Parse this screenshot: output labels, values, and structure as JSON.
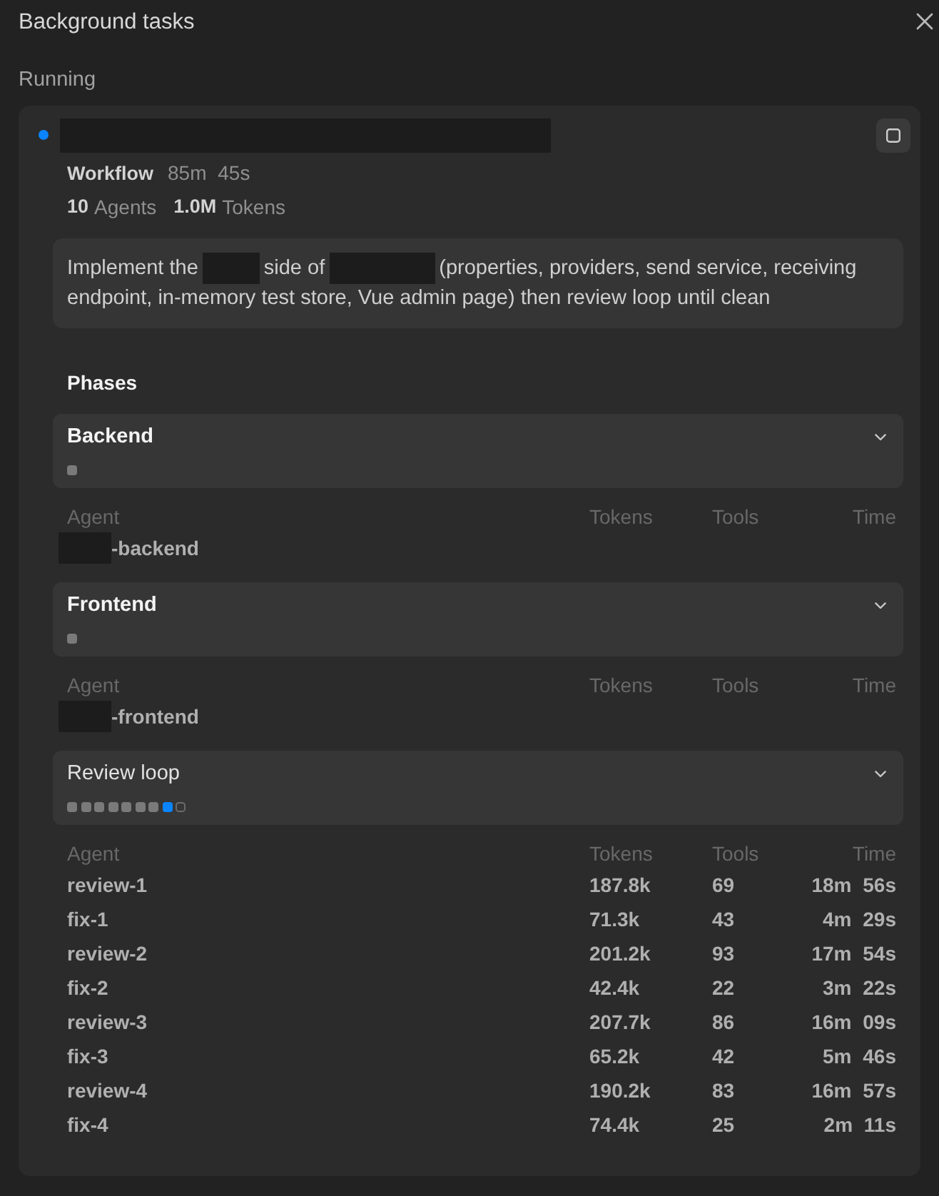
{
  "window": {
    "title": "Background tasks"
  },
  "section": {
    "label": "Running"
  },
  "task": {
    "running": true,
    "title": [
      {
        "kind": "redacted"
      }
    ],
    "type_label": "Workflow",
    "duration": "85m 45s",
    "stats": [
      {
        "count": "10",
        "unit": "Agents"
      },
      {
        "count": "1.0M",
        "unit": "Tokens"
      }
    ],
    "description": [
      [
        {
          "kind": "text",
          "text": "Implement the"
        },
        {
          "kind": "redacted"
        },
        {
          "kind": "text",
          "text": "side of"
        },
        {
          "kind": "redacted"
        },
        {
          "kind": "text",
          "text": "(properties, providers, send service, receiving"
        }
      ],
      [
        {
          "kind": "text",
          "text": "endpoint, in-memory test store, Vue admin page) then review loop until clean"
        }
      ]
    ],
    "phases_label": "Phases",
    "phases": [
      {
        "name": "Backend",
        "running": false,
        "expanded": true,
        "steps": [
          {
            "done": true,
            "active": false
          }
        ],
        "columns": [
          "Agent",
          "Tokens",
          "Tools",
          "Time"
        ],
        "rows": [
          {
            "agent": [
              {
                "kind": "redacted"
              },
              {
                "kind": "text",
                "text": "-backend"
              }
            ]
          }
        ]
      },
      {
        "name": "Frontend",
        "running": false,
        "expanded": true,
        "steps": [
          {
            "done": true,
            "active": false
          }
        ],
        "columns": [
          "Agent",
          "Tokens",
          "Tools",
          "Time"
        ],
        "rows": [
          {
            "agent": [
              {
                "kind": "redacted"
              },
              {
                "kind": "text",
                "text": "-frontend"
              }
            ]
          }
        ]
      },
      {
        "name": "Review loop",
        "running": true,
        "expanded": true,
        "steps": [
          {
            "done": true,
            "active": false
          },
          {
            "done": true,
            "active": false
          },
          {
            "done": true,
            "active": false
          },
          {
            "done": true,
            "active": false
          },
          {
            "done": true,
            "active": false
          },
          {
            "done": true,
            "active": false
          },
          {
            "done": true,
            "active": false
          },
          {
            "done": false,
            "active": true
          },
          {
            "done": false,
            "active": false
          }
        ],
        "columns": [
          "Agent",
          "Tokens",
          "Tools",
          "Time"
        ],
        "rows": [
          {
            "agent": [
              {
                "kind": "text",
                "text": "review-1"
              }
            ],
            "tokens": "187.8k",
            "tools": "69",
            "time": "18m 56s"
          },
          {
            "agent": [
              {
                "kind": "text",
                "text": "fix-1"
              }
            ],
            "tokens": "71.3k",
            "tools": "43",
            "time": "4m 29s"
          },
          {
            "agent": [
              {
                "kind": "text",
                "text": "review-2"
              }
            ],
            "tokens": "201.2k",
            "tools": "93",
            "time": "17m 54s"
          },
          {
            "agent": [
              {
                "kind": "text",
                "text": "fix-2"
              }
            ],
            "tokens": "42.4k",
            "tools": "22",
            "time": "3m 22s"
          },
          {
            "agent": [
              {
                "kind": "text",
                "text": "review-3"
              }
            ],
            "tokens": "207.7k",
            "tools": "86",
            "time": "16m 09s"
          },
          {
            "agent": [
              {
                "kind": "text",
                "text": "fix-3"
              }
            ],
            "tokens": "65.2k",
            "tools": "42",
            "time": "5m 46s"
          },
          {
            "agent": [
              {
                "kind": "text",
                "text": "review-4"
              }
            ],
            "tokens": "190.2k",
            "tools": "83",
            "time": "16m 57s"
          },
          {
            "agent": [
              {
                "kind": "text",
                "text": "fix-4"
              }
            ],
            "tokens": "74.4k",
            "tools": "25",
            "time": "2m 11s"
          }
        ]
      }
    ]
  }
}
